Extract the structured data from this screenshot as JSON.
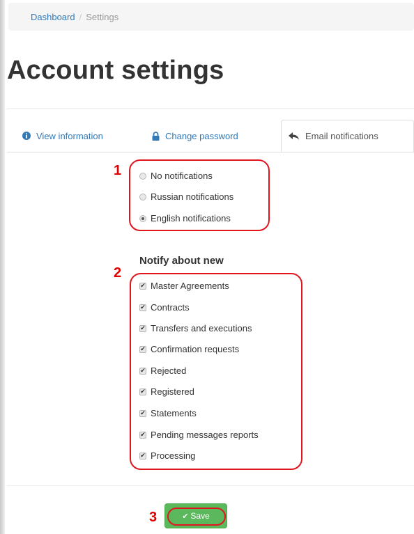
{
  "breadcrumb": {
    "home": "Dashboard",
    "separator": "/",
    "current": "Settings"
  },
  "page": {
    "title": "Account settings"
  },
  "tabs": [
    {
      "label": "View information",
      "icon": "info-circle-icon",
      "active": false
    },
    {
      "label": "Change password",
      "icon": "lock-icon",
      "active": false
    },
    {
      "label": "Email notifications",
      "icon": "reply-arrow-icon",
      "active": true
    }
  ],
  "markers": {
    "one": "1",
    "two": "2",
    "three": "3"
  },
  "notification_language": {
    "options": [
      {
        "label": "No notifications",
        "selected": false
      },
      {
        "label": "Russian notifications",
        "selected": false
      },
      {
        "label": "English notifications",
        "selected": true
      }
    ]
  },
  "notify_about": {
    "heading": "Notify about new",
    "items": [
      {
        "label": "Master Agreements",
        "checked": true
      },
      {
        "label": "Contracts",
        "checked": true
      },
      {
        "label": "Transfers and executions",
        "checked": true
      },
      {
        "label": "Confirmation requests",
        "checked": true
      },
      {
        "label": "Rejected",
        "checked": true
      },
      {
        "label": "Registered",
        "checked": true
      },
      {
        "label": "Statements",
        "checked": true
      },
      {
        "label": "Pending messages reports",
        "checked": true
      },
      {
        "label": "Processing",
        "checked": true
      }
    ]
  },
  "actions": {
    "save_label": "Save"
  },
  "colors": {
    "link": "#337ab7",
    "save_button": "#5cb85c",
    "annotation_red": "#e2141e"
  }
}
